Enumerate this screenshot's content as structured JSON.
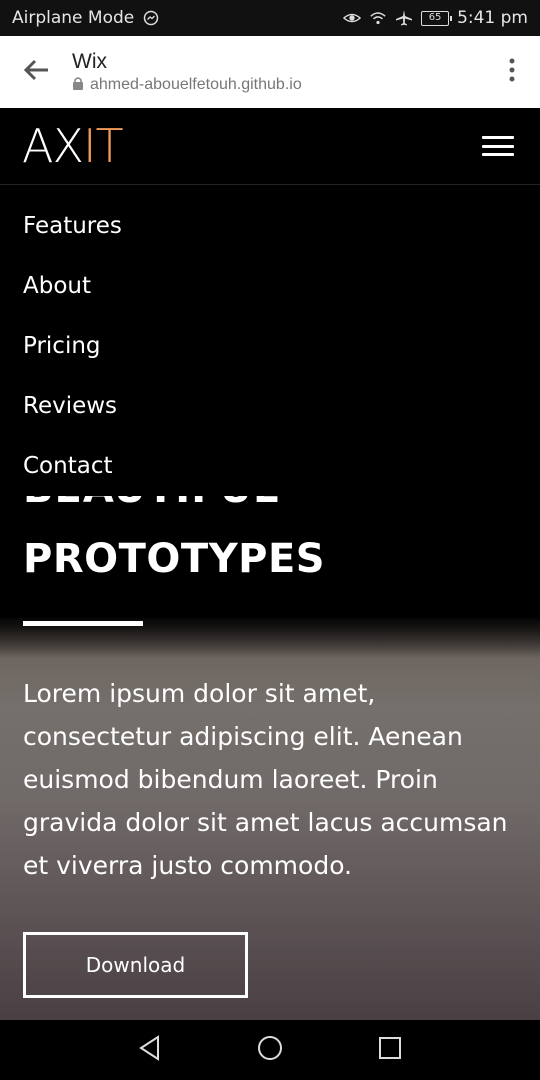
{
  "status_bar": {
    "left_text": "Airplane Mode",
    "battery": "65",
    "time": "5:41 pm",
    "icons": [
      "messenger-icon",
      "eye-icon",
      "wifi-icon",
      "airplane-icon",
      "battery-icon"
    ]
  },
  "browser": {
    "title": "Wix",
    "url": "ahmed-abouelfetouh.github.io",
    "icons": [
      "back-arrow-icon",
      "lock-icon",
      "more-vert-icon"
    ]
  },
  "site": {
    "logo_main": "AX",
    "logo_accent": "IT",
    "accent_color": "#f39c5a",
    "nav": [
      "Features",
      "About",
      "Pricing",
      "Reviews",
      "Contact"
    ],
    "hero_title_hidden": "BEAUTIFUL",
    "hero_title": "PROTOTYPES",
    "hero_text": "Lorem ipsum dolor sit amet, consectetur adipiscing elit. Aenean euismod bibendum laoreet. Proin gravida dolor sit amet lacus accumsan et viverra justo commodo.",
    "download_label": "Download"
  },
  "android_nav": {
    "icons": [
      "back-triangle-icon",
      "home-circle-icon",
      "recents-square-icon"
    ]
  }
}
